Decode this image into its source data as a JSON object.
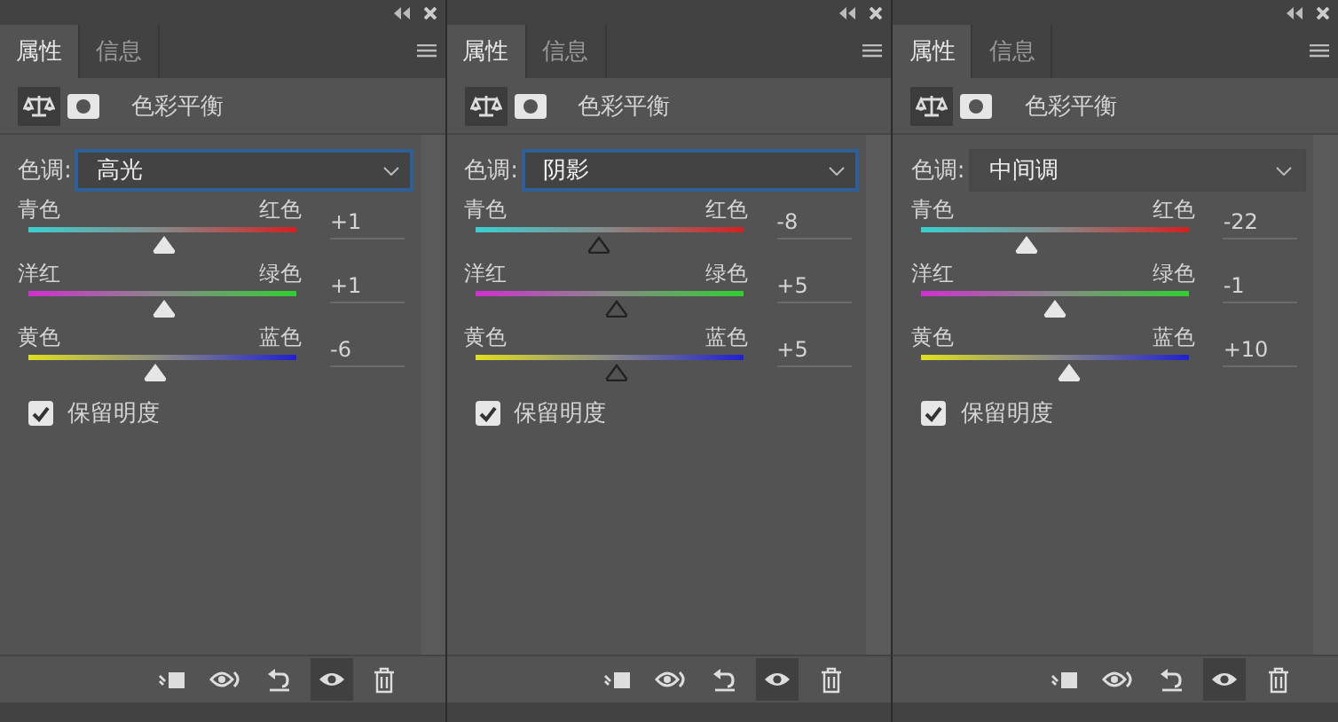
{
  "panels": [
    {
      "tabs": [
        {
          "label": "属性",
          "selected": true
        },
        {
          "label": "信息",
          "selected": false
        }
      ],
      "title": "色彩平衡",
      "tone": {
        "label": "色调:",
        "value": "高光",
        "focused": true
      },
      "sliders": [
        {
          "left": "青色",
          "right": "红色",
          "value": "+1",
          "level": 0.505
        },
        {
          "left": "洋红",
          "right": "绿色",
          "value": "+1",
          "level": 0.505
        },
        {
          "left": "黄色",
          "right": "蓝色",
          "value": "-6",
          "level": 0.47
        }
      ],
      "hollow_thumbs": false,
      "preserve": {
        "label": "保留明度",
        "checked": true
      },
      "toolbar": [
        {
          "kind": "clip",
          "selected": false
        },
        {
          "kind": "view-previous",
          "selected": false
        },
        {
          "kind": "reset",
          "selected": false
        },
        {
          "kind": "visibility",
          "selected": true
        },
        {
          "kind": "delete",
          "selected": false
        }
      ]
    },
    {
      "tabs": [
        {
          "label": "属性",
          "selected": true
        },
        {
          "label": "信息",
          "selected": false
        }
      ],
      "title": "色彩平衡",
      "tone": {
        "label": "色调:",
        "value": "阴影",
        "focused": true
      },
      "sliders": [
        {
          "left": "青色",
          "right": "红色",
          "value": "-8",
          "level": 0.46
        },
        {
          "left": "洋红",
          "right": "绿色",
          "value": "+5",
          "level": 0.525
        },
        {
          "left": "黄色",
          "right": "蓝色",
          "value": "+5",
          "level": 0.525
        }
      ],
      "hollow_thumbs": true,
      "preserve": {
        "label": "保留明度",
        "checked": true
      },
      "toolbar": [
        {
          "kind": "clip",
          "selected": false
        },
        {
          "kind": "view-previous",
          "selected": false
        },
        {
          "kind": "reset",
          "selected": false
        },
        {
          "kind": "visibility",
          "selected": true
        },
        {
          "kind": "delete",
          "selected": false
        }
      ]
    },
    {
      "tabs": [
        {
          "label": "属性",
          "selected": true
        },
        {
          "label": "信息",
          "selected": false
        }
      ],
      "title": "色彩平衡",
      "tone": {
        "label": "色调:",
        "value": "中间调",
        "focused": false
      },
      "sliders": [
        {
          "left": "青色",
          "right": "红色",
          "value": "-22",
          "level": 0.39
        },
        {
          "left": "洋红",
          "right": "绿色",
          "value": "-1",
          "level": 0.495
        },
        {
          "left": "黄色",
          "right": "蓝色",
          "value": "+10",
          "level": 0.55
        }
      ],
      "hollow_thumbs": false,
      "preserve": {
        "label": "保留明度",
        "checked": true
      },
      "toolbar": [
        {
          "kind": "clip",
          "selected": false
        },
        {
          "kind": "view-previous",
          "selected": false
        },
        {
          "kind": "reset",
          "selected": false
        },
        {
          "kind": "visibility",
          "selected": true
        },
        {
          "kind": "delete",
          "selected": false
        }
      ]
    }
  ]
}
